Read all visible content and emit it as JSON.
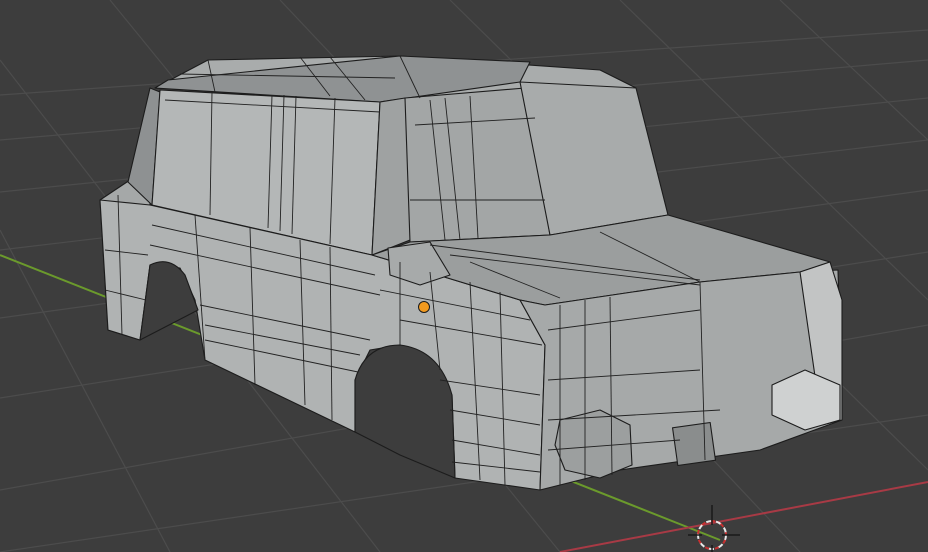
{
  "viewport": {
    "mode": "3D Viewport",
    "selected_object": "car-body-mesh"
  },
  "colors": {
    "background": "#3d3d3d",
    "grid_line": "#4a4a4a",
    "x_axis": "#a83a45",
    "y_axis": "#6b9a2c",
    "mesh_light": "#b9bcbc",
    "mesh_mid": "#9ea1a1",
    "mesh_dark": "#7c7f80",
    "wire": "#1a1a1a",
    "origin": "#f29a1f"
  }
}
